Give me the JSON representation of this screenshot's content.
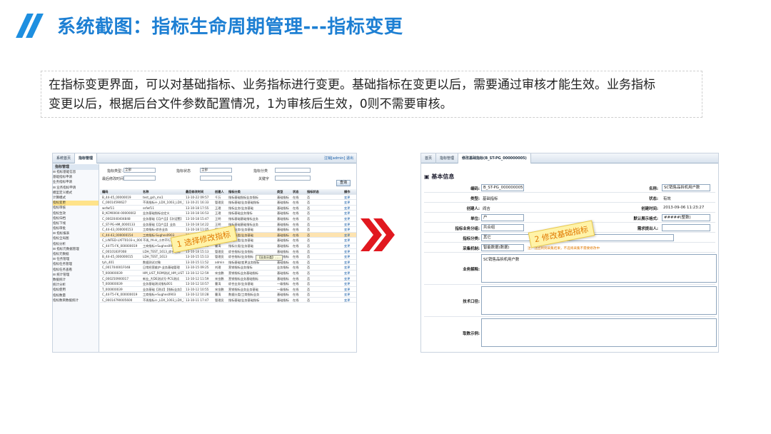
{
  "slide": {
    "title": "系统截图：指标生命周期管理---指标变更",
    "description_line1": "在指标变更界面，可以对基础指标、业务指标进行变更。基础指标在变更以后，需要通过审核才能生效。业务指标",
    "description_line2": "变更以后，根据后台文件参数配置情况，1为审核后生效，0则不需要审核。"
  },
  "callouts": {
    "step1": "1 选择修改指标",
    "step2": "2 修改基础指标"
  },
  "left_screen": {
    "tabs": [
      "系统首页",
      "指标管理"
    ],
    "tabbar_right": "注销[admin] 退出",
    "tree_header": "指标管理",
    "tree_items": [
      "⊟ 指标基础信息",
      "  基础指标申请",
      "  业务指标申请",
      "⊟ 业务指标申请",
      "  模型定义模式",
      "  计算模式",
      "  指标变更",
      "  指标审核",
      "  指标生效",
      "  指标归档",
      "  指标下线",
      "  指标审批",
      "⊟ 指标报表",
      "  指标全局图",
      "  指标分析",
      "⊟ 指标元数据管理",
      "  指标元数据",
      "⊟ 任务管理",
      "  指标任务管理",
      "  指标任务查看",
      "⊟ 统计管理",
      "  数据统计",
      "  统计分析",
      "  指标使用",
      "  指标数量",
      "  指标数目数据统计"
    ],
    "filters": {
      "type_label": "指标类型：",
      "type_value": "全部",
      "status_label": "指标状态",
      "status_value": "全部",
      "category_label": "指标分类",
      "time_label": "最后修改时间",
      "keyword_label": "关键字",
      "query_button": "查询"
    },
    "columns": [
      "编码",
      "名称",
      "最后修改时间",
      "创建人",
      "指标分类",
      "类型",
      "状态",
      "指标状态",
      "操作"
    ],
    "rows": [
      [
        "B_44-45_00000019",
        "test_gsh_ms1",
        "13-10-22 09:57",
        "千万",
        "指标基础指标业务指标",
        "基础指标",
        "在线",
        "否",
        "变更"
      ],
      [
        "C_00014590627",
        "不再指标十_LDX_1003_LDX_11",
        "13-10-21 16:33",
        "管理员",
        "指标基础/业务基础指标",
        "基础指标",
        "在线",
        "否",
        "变更"
      ],
      [
        "wsfwf11",
        "ssfwf11",
        "13-10-18 17:55",
        "王理",
        "指标业务/业务基础",
        "基础指标",
        "在线",
        "否",
        "变更"
      ],
      [
        "B_KCM0004-00000002",
        "业务基础指标自定义",
        "13-10-18 16:53",
        "王理",
        "指标基础业务指标",
        "基础指标",
        "在线",
        "否",
        "变更"
      ],
      [
        "C_0002040404848",
        "业务基础【月产品】【次设置】",
        "13-10-18 15:47",
        "王明",
        "指标基础基础指标业务",
        "基础指标",
        "在线",
        "否",
        "变更"
      ],
      [
        "C_ST-PG-HM_0000133",
        "业务基础【月产品】业务",
        "13-10-18 14:22",
        "王明",
        "指标基础基础指标业务",
        "基础指标",
        "在线",
        "否",
        "变更"
      ],
      [
        "C_44-43_000000153",
        "工商指标-综合业务",
        "13-10-18 11:05",
        "管理员",
        "指标业务/业务基础",
        "基础指标",
        "在线",
        "否",
        "变更"
      ],
      [
        "C_44-43_000000154",
        "工商指标-Sughes0903",
        "13-10-18 10:07",
        "曹涛",
        "指标分类/业务基础",
        "基础指标",
        "在线",
        "否",
        "变更"
      ],
      [
        "C_LINTED-LXFT0103-x_000000",
        "不再_YA-H_小并不行业务基础",
        "13-10-18 09:55",
        "曹涛",
        "数据分类/业务基础",
        "基础指标",
        "在线",
        "否",
        "变更"
      ],
      [
        "C_44-T5-FK_000000019",
        "工商指标+Sughes0903",
        "13-10-18 09:39",
        "曹涛",
        "指标分类/业务基础",
        "基础指标",
        "在线",
        "否",
        "变更"
      ],
      [
        "C_0010183F008",
        "LDH_TEST_1613_综合指标",
        "13-10-18 15:13",
        "管理员",
        "综合指标/业务指标",
        "基础指标",
        "在线",
        "否",
        "变更"
      ],
      [
        "B_44-45_000000015",
        "LDH_TEST_1613",
        "13-10-15 15:13",
        "管理员",
        "综合指标/业务指标",
        "基础指标",
        "在线",
        "否",
        "变更"
      ],
      [
        "tyh_401",
        "数据测试对象",
        "13-10-15 11:52",
        "admin",
        "指标基础/变更业务指标",
        "基础指标",
        "在线",
        "否",
        "变更"
      ],
      [
        "C_001704001F048",
        "日常经营维护-业务基础管理",
        "13-10-15 09:25",
        "刘理",
        "营销指标业务指标",
        "业务指标",
        "在线",
        "否",
        "变更"
      ],
      [
        "T_000000039",
        "HM_LIST_ROM测试_HM_LIST",
        "13-10-12 12:59",
        "宋金鹏",
        "营销指标业务基础指标",
        "基础指标",
        "在线",
        "否",
        "变更"
      ],
      [
        "C_000250900017",
        "新业_大DE测试号-PCS测试",
        "13-10-12 11:59",
        "宋金鹏",
        "营销指标业务基础指标",
        "基础指标",
        "在线",
        "否",
        "变更"
      ],
      [
        "T_000000039",
        "业务基础测试指标001",
        "13-10-12 10:57",
        "曹涛",
        "综合业务/业务基础",
        "一级指标",
        "在线",
        "否",
        "变更"
      ],
      [
        "T_000000039",
        "业务基础【测试】【指标业务】",
        "13-10-12 10:55",
        "宋金鹏",
        "营销指标业务业务基础",
        "一级指标",
        "在线",
        "否",
        "变更"
      ],
      [
        "C_44-T5-FK_000000019",
        "工商指标+Sughes0903",
        "13-10-12 10:28",
        "曹涛",
        "数据分类/工商指标业务",
        "基础指标",
        "在线",
        "否",
        "变更"
      ],
      [
        "C_00014790005600",
        "不再指标十_LDX_1003_LDX_11",
        "13-10-11 17:47",
        "管理员",
        "指标基础/业务基础指标",
        "基础指标",
        "在线",
        "否",
        "变更"
      ]
    ],
    "tooltip": "【业务分类】……"
  },
  "right_screen": {
    "tabs": [
      "首页",
      "指标管理",
      "修改基础指标(B_ST-PG_000000005)"
    ],
    "section_title": "基本信息",
    "fields": {
      "code_label": "编码:",
      "code_value": "B_ST-PG_000000005",
      "name_label": "名称:",
      "name_value": "SC销售品拆机用户数",
      "type_label": "类型:",
      "type_value": "基础指标",
      "status_label": "状态:",
      "status_value": "有效",
      "creator_label": "创建人:",
      "creator_value": "阎吉",
      "created_label": "创建时间:",
      "created_value": "2013-09-06 11:23:27",
      "unit_label": "单位:",
      "unit_value": "户",
      "display_label": "默认展示格式:",
      "display_value": "#####(整数)",
      "group_label": "指标业务分组:",
      "group_value": "共合组",
      "owner_label": "需求提出人:",
      "category_label": "指标分类:",
      "category_value": "其它",
      "dimension_label": "采集机制:",
      "dimension_value": "智能数据(数据)",
      "dimension_note": "注：注回到到采集结果，不选将采集不需要修改中",
      "biz_label": "业务解释:",
      "biz_value": "SC销售品拆机用户数",
      "tech_label": "技术口径:",
      "example_label": "取数示例:"
    }
  }
}
